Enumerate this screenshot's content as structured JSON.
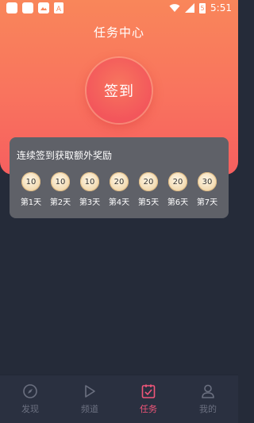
{
  "status_bar": {
    "time": "5:51",
    "battery_level": "5"
  },
  "header": {
    "title": "任务中心"
  },
  "checkin": {
    "button_label": "签到"
  },
  "reward_card": {
    "title": "连续签到获取额外奖励",
    "days": [
      {
        "points": "10",
        "label": "第1天"
      },
      {
        "points": "10",
        "label": "第2天"
      },
      {
        "points": "10",
        "label": "第3天"
      },
      {
        "points": "20",
        "label": "第4天"
      },
      {
        "points": "20",
        "label": "第5天"
      },
      {
        "points": "20",
        "label": "第6天"
      },
      {
        "points": "30",
        "label": "第7天"
      }
    ]
  },
  "tabbar": {
    "tabs": [
      {
        "label": "发现",
        "icon": "compass-icon",
        "active": false
      },
      {
        "label": "频道",
        "icon": "play-icon",
        "active": false
      },
      {
        "label": "任务",
        "icon": "task-checklist-icon",
        "active": true
      },
      {
        "label": "我的",
        "icon": "user-icon",
        "active": false
      }
    ]
  },
  "colors": {
    "accent": "#f2567a",
    "hero_top": "#f9865a",
    "hero_bottom": "#f65f5f",
    "background": "#252b39",
    "card": "#5f6168",
    "coin": "#f3ddb6"
  }
}
